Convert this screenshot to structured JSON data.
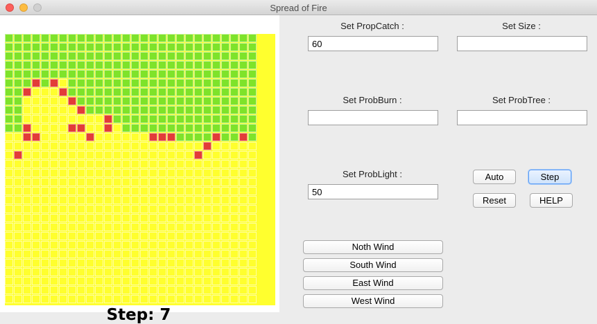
{
  "window": {
    "title": "Spread of Fire"
  },
  "simulation": {
    "step_text": "Step: 7",
    "grid_legend": {
      "0": "empty",
      "1": "tree",
      "2": "fire"
    },
    "grid": [
      "1111111111111111111111111111",
      "1111111111111111111111111111",
      "1111111111111111111111111111",
      "1111111111111111111111111111",
      "1111111111111111111111111111",
      "1112120111111111111111111111",
      "1120002111111111111111111111",
      "1100000211111111111111111111",
      "1100000021111111111111111111",
      "1100000000021111111111111111",
      "1120000220020111111111111111",
      "0022000002000000222111121121",
      "0000000000000000000000200000",
      "0200000000000000000002000000",
      "0000000000000000000000000000",
      "0000000000000000000000000000",
      "0000000000000000000000000000",
      "0000000000000000000000000000",
      "0000000000000000000000000000",
      "0000000000000000000000000000",
      "0000000000000000000000000000",
      "0000000000000000000000000000",
      "0000000000000000000000000000",
      "0000000000000000000000000000",
      "0000000000000000000000000000",
      "0000000000000000000000000000",
      "0000000000000000000000000000",
      "0000000000000000000000000000",
      "0000000000000000000000000000",
      "0000000000000000000000000000"
    ]
  },
  "controls": {
    "prop_catch": {
      "label": "Set PropCatch :",
      "value": "60"
    },
    "size": {
      "label": "Set Size :",
      "value": ""
    },
    "prob_burn": {
      "label": "Set ProbBurn :",
      "value": ""
    },
    "prob_tree": {
      "label": "Set ProbTree :",
      "value": ""
    },
    "prob_light": {
      "label": "Set ProbLight :",
      "value": "50"
    }
  },
  "buttons": {
    "auto": "Auto",
    "step": "Step",
    "reset": "Reset",
    "help": "HELP",
    "north_wind": "Noth Wind",
    "south_wind": "South Wind",
    "east_wind": "East Wind",
    "west_wind": "West Wind"
  }
}
